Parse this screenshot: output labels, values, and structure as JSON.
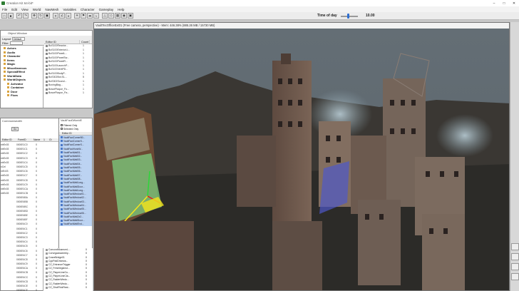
{
  "app": {
    "title": "Creation Kit 64-bit*",
    "controls": [
      "–",
      "□",
      "✕"
    ]
  },
  "menu": [
    "File",
    "Edit",
    "View",
    "World",
    "NavMesh",
    "Variables",
    "Character",
    "Gameplay",
    "Help"
  ],
  "toolbar": {
    "time_of_day_label": "Time of day",
    "time_of_day_value": "10.00",
    "time_of_day_fraction": 0.42
  },
  "object_window": {
    "title": "Object Window",
    "layout_label": "Layout",
    "layout_value": "Default",
    "filter_label": "Filter",
    "editor_id_header": "Editor ID",
    "count_header": "Count",
    "tree": [
      {
        "label": "Actors",
        "sub": false
      },
      {
        "label": "Audio",
        "sub": false
      },
      {
        "label": "Character",
        "sub": false
      },
      {
        "label": "Items",
        "sub": false
      },
      {
        "label": "Magic",
        "sub": false
      },
      {
        "label": "Miscellaneous",
        "sub": false
      },
      {
        "label": "SpecialEffect",
        "sub": false
      },
      {
        "label": "WorldData",
        "sub": false
      },
      {
        "label": "WorldObjects",
        "sub": false
      },
      {
        "label": "Activator",
        "sub": true
      },
      {
        "label": "Container",
        "sub": true
      },
      {
        "label": "Door",
        "sub": true
      },
      {
        "label": "Flora",
        "sub": true
      }
    ],
    "rows": [
      {
        "id": "BoS100Reactor...",
        "count": "1"
      },
      {
        "id": "BoS100ExteriorLi...",
        "count": "1"
      },
      {
        "id": "BoS100PanelL...",
        "count": "1"
      },
      {
        "id": "BoS100PanelSw...",
        "count": "1"
      },
      {
        "id": "BoS100PanelR...",
        "count": "1"
      },
      {
        "id": "BoS100LaunchP...",
        "count": "1"
      },
      {
        "id": "BoS100VertiPD...",
        "count": "1"
      },
      {
        "id": "BoS100BodyP...",
        "count": "1"
      },
      {
        "id": "BoS302Bot.SL...",
        "count": "5"
      },
      {
        "id": "BoS302Sound...",
        "count": "1"
      },
      {
        "id": "BoxingBag...",
        "count": "1"
      },
      {
        "id": "BracePlaque_Fo...",
        "count": "1"
      },
      {
        "id": "BracePlaque_Pa...",
        "count": "1"
      }
    ]
  },
  "cell_window": {
    "title": "Commonwealth",
    "go_label": "Go",
    "headers": [
      "Editor ID",
      "FormID",
      "Name",
      "1",
      "Ct"
    ],
    "rows": [
      {
        "ed": "ntrEx03",
        "form": "0000E1C0",
        "num": "0"
      },
      {
        "ed": "ntrEx03",
        "form": "0000E1C1",
        "num": "0"
      },
      {
        "ed": "ntrEx03",
        "form": "0000E1C2",
        "num": "0"
      },
      {
        "ed": "ntrEx03",
        "form": "0000E1C3",
        "num": "0"
      },
      {
        "ed": "ntrEx03",
        "form": "0000E1C4",
        "num": "0"
      },
      {
        "ed": "nCel",
        "form": "0000E1C5",
        "num": "0"
      },
      {
        "ed": "nrEx03",
        "form": "0000E1C6",
        "num": "0"
      },
      {
        "ed": "ntrEx03",
        "form": "0000E1C7",
        "num": "0"
      },
      {
        "ed": "ntrEx03",
        "form": "0000E1C8",
        "num": "0"
      },
      {
        "ed": "ntrEx03",
        "form": "0000E1C9",
        "num": "0"
      },
      {
        "ed": "ntrEx03",
        "form": "0000E1CA",
        "num": "0"
      },
      {
        "ed": "ntrEx03",
        "form": "0000E1CB",
        "num": "0"
      },
      {
        "ed": "",
        "form": "0000E4BA",
        "num": "0"
      },
      {
        "ed": "",
        "form": "0000E4BB",
        "num": "0"
      },
      {
        "ed": "",
        "form": "0000E4BC",
        "num": "0"
      },
      {
        "ed": "",
        "form": "0000E4BD",
        "num": "0"
      },
      {
        "ed": "",
        "form": "0000E4BE",
        "num": "0"
      },
      {
        "ed": "",
        "form": "0000E4BF",
        "num": "0"
      },
      {
        "ed": "",
        "form": "0000E4C0",
        "num": "0"
      },
      {
        "ed": "",
        "form": "0000E4C1",
        "num": "0"
      },
      {
        "ed": "",
        "form": "0000E4C2",
        "num": "0"
      },
      {
        "ed": "",
        "form": "0000E4C3",
        "num": "0"
      },
      {
        "ed": "",
        "form": "0000E4C4",
        "num": "0"
      },
      {
        "ed": "",
        "form": "0000E4C5",
        "num": "0"
      },
      {
        "ed": "",
        "form": "0000E4C6",
        "num": "0"
      },
      {
        "ed": "",
        "form": "0000E4C7",
        "num": "0"
      },
      {
        "ed": "",
        "form": "0000E4C8",
        "num": "0"
      },
      {
        "ed": "",
        "form": "0000E4C9",
        "num": "0"
      },
      {
        "ed": "",
        "form": "0000E4CA",
        "num": "0"
      },
      {
        "ed": "",
        "form": "0000E4CB",
        "num": "0"
      },
      {
        "ed": "",
        "form": "0000E4CC",
        "num": "0"
      },
      {
        "ed": "",
        "form": "0000E4CD",
        "num": "0"
      },
      {
        "ed": "",
        "form": "0000E4CE",
        "num": "0"
      },
      {
        "ed": "",
        "form": "0000E4CF",
        "num": "0"
      },
      {
        "ed": "",
        "form": "0000E4D0",
        "num": "0"
      }
    ]
  },
  "ref_window": {
    "title": "VaultFaci0WorldE",
    "filtered_only": "Filtered Only",
    "selected_only": "Selected Only",
    "header": "Editor ID",
    "rows": [
      {
        "id": "VaultFaciCornerB0...",
        "sel": true
      },
      {
        "id": "VaultFaciCornerS...",
        "sel": true
      },
      {
        "id": "VaultFaciCornerS...",
        "sel": true
      },
      {
        "id": "VaultFaciHorizW...",
        "sel": true
      },
      {
        "id": "VaultFaciWall01...",
        "sel": true
      },
      {
        "id": "VaultFaciWall02...",
        "sel": true
      },
      {
        "id": "VaultFaciWall03...",
        "sel": true
      },
      {
        "id": "VaultFaciWall04...",
        "sel": true
      },
      {
        "id": "VaultFaciWall05...",
        "sel": true
      },
      {
        "id": "VaultFaciWall06...",
        "sel": true
      },
      {
        "id": "VaultFaciWall07...",
        "sel": true
      },
      {
        "id": "VaultFaciWall08...",
        "sel": true
      },
      {
        "id": "VaultFaciWallLong...",
        "sel": true
      },
      {
        "id": "VaultFaciWallDoor...",
        "sel": true
      },
      {
        "id": "VaultFaciWallLong...",
        "sel": true
      },
      {
        "id": "VaultFaciWindow01...",
        "sel": true
      },
      {
        "id": "VaultFaciWindow02...",
        "sel": true
      },
      {
        "id": "VaultFaciWindow03...",
        "sel": true
      },
      {
        "id": "VaultFaciWindow04...",
        "sel": true
      },
      {
        "id": "VaultFaciWindow05...",
        "sel": true
      },
      {
        "id": "VaultFaciWindow06...",
        "sel": true
      },
      {
        "id": "VaultFaciWall2x2...",
        "sel": true
      },
      {
        "id": "VaultFaciWallDoor...",
        "sel": true
      },
      {
        "id": "VaultFaciWallEnd...",
        "sel": true
      }
    ]
  },
  "bottom_list": {
    "rows": [
      {
        "id": "ConcordMuseumL...",
        "count": "0"
      },
      {
        "id": "CorvegaAssembly...",
        "count": "0"
      },
      {
        "id": "CraneBridge01",
        "count": "0"
      },
      {
        "id": "CppPadDrivewa...",
        "count": "0"
      },
      {
        "id": "CZ_EntranceTrigger",
        "count": "0"
      },
      {
        "id": "CZ_FreshlegsInst...",
        "count": "0"
      },
      {
        "id": "CZ_PlayerLineGo...",
        "count": "0"
      },
      {
        "id": "CZ_PlayerLineCla...",
        "count": "0"
      },
      {
        "id": "CZ_RaiderWindo...",
        "count": "0"
      },
      {
        "id": "CZ_RaiderWindo...",
        "count": "0"
      },
      {
        "id": "CZ_ShotFlickReal...",
        "count": "0"
      }
    ]
  },
  "viewport": {
    "title": "VaultTecOfficeExt01 (Free camera, perspective) - Mem: 446.38% (885.26 MB / 15730 MB)"
  },
  "colors": {
    "sky": "#5f6a71",
    "ground": "#2b2a27",
    "building": "#6e5a4e",
    "fog": "#9fb3bd",
    "selection": "#7cc47a",
    "gizmo_yellow": "#f5e51c",
    "gizmo_red": "#e0201c"
  }
}
